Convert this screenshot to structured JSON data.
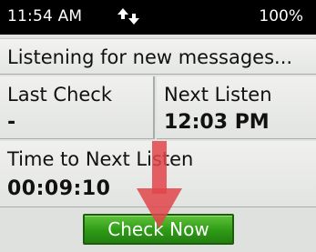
{
  "status_bar": {
    "time": "11:54 AM",
    "sync_icon": "sync-arrows-icon",
    "battery": "100%"
  },
  "banner": {
    "text": "Listening for new messages..."
  },
  "last_check": {
    "label": "Last Check",
    "value": "-"
  },
  "next_listen": {
    "label": "Next Listen",
    "value": "12:03 PM"
  },
  "time_to_next": {
    "label": "Time to Next Listen",
    "value": "00:09:10"
  },
  "actions": {
    "check_now_label": "Check Now"
  },
  "colors": {
    "button_green": "#2e9a16",
    "arrow_red": "#e0454a",
    "screen_bg": "#e1e3e0"
  }
}
